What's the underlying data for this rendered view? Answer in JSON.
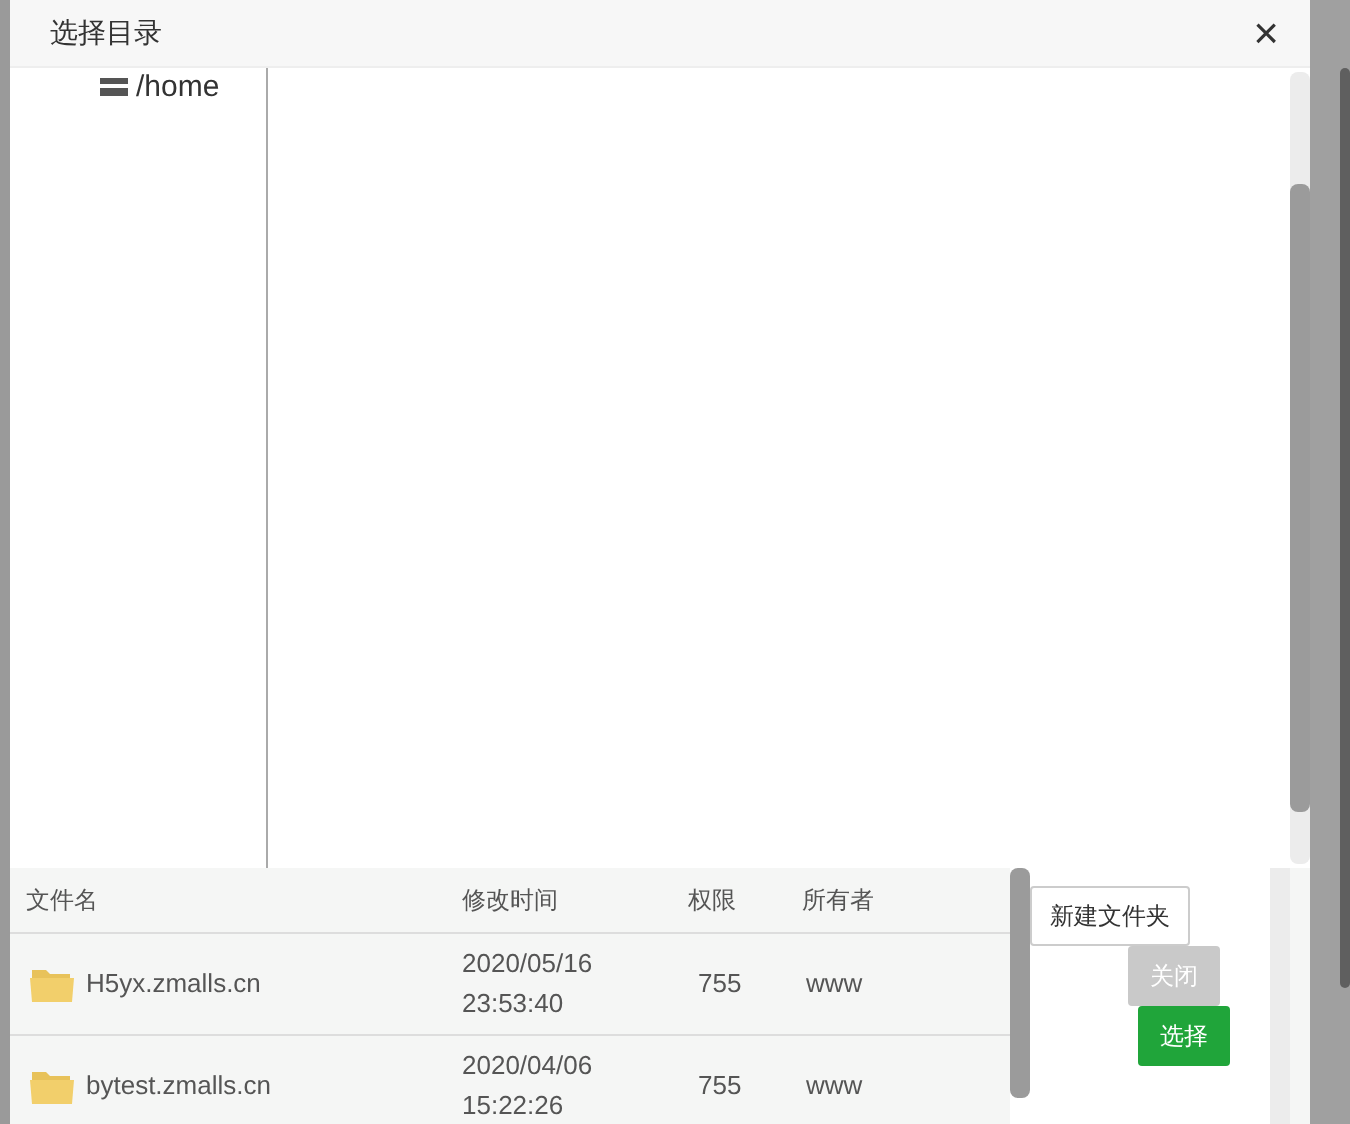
{
  "dialog": {
    "title": "选择目录",
    "close": "×"
  },
  "tree": {
    "items": [
      {
        "label": "/home"
      }
    ]
  },
  "table": {
    "columns": [
      "文件名",
      "修改时间",
      "权限",
      "所有者"
    ],
    "rows": [
      {
        "name": "H5yx.zmalls.cn",
        "modified": [
          "2020/05/16",
          "23:53:40"
        ],
        "permission": "755",
        "owner": "www"
      },
      {
        "name": "bytest.zmalls.cn",
        "modified": [
          "2020/04/06",
          "15:22:26"
        ],
        "permission": "755",
        "owner": "www"
      }
    ]
  },
  "buttons": [
    {
      "label": "新建文件夹",
      "kind": "outline"
    },
    {
      "label": "关闭",
      "kind": "disabled"
    },
    {
      "label": "选择",
      "kind": "primary"
    }
  ]
}
